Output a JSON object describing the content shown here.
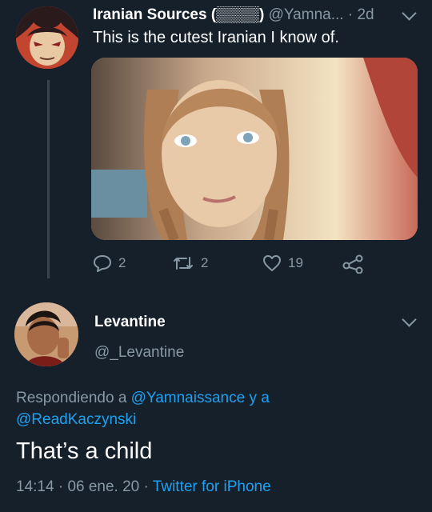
{
  "tweet1": {
    "display_name": "Iranian Sources (▒▒▒▒)",
    "handle": "@Yamna...",
    "time_sep": " · ",
    "time": "2d",
    "text": "This is the cutest Iranian I know of.",
    "avatar_icon": "cartoon-avatar-icon",
    "actions": {
      "replies": "2",
      "retweets": "2",
      "likes": "19"
    }
  },
  "tweet2": {
    "display_name": "Levantine",
    "handle": "@_Levantine",
    "replying_prefix": "Respondiendo a ",
    "replying_user1": "@Yamnaissance",
    "replying_joiner": " y a",
    "replying_user2": "@ReadKaczynski",
    "text": "That’s a child",
    "time": "14:14",
    "sep": " · ",
    "date": "06 ene. 20",
    "client": "Twitter for iPhone"
  },
  "colors": {
    "background": "#15202b",
    "primary_text": "#ffffff",
    "secondary_text": "#8899a6",
    "link": "#1da1f2",
    "thread_line": "#38444d"
  }
}
